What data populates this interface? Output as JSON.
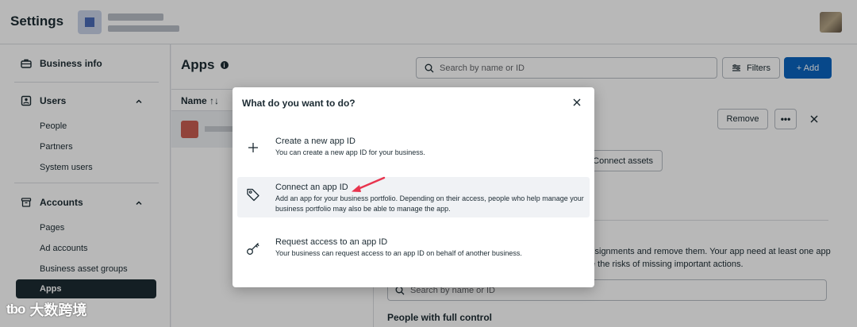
{
  "topbar": {
    "title": "Settings",
    "account_avatar_letter": "",
    "user_avatar": "user-avatar-photo"
  },
  "sidebar": {
    "business_info": "Business info",
    "users": {
      "label": "Users",
      "items": [
        "People",
        "Partners",
        "System users"
      ]
    },
    "accounts": {
      "label": "Accounts",
      "items": [
        "Pages",
        "Ad accounts",
        "Business asset groups",
        "Apps"
      ]
    },
    "active_item": "Apps"
  },
  "main": {
    "title": "Apps",
    "search_placeholder": "Search by name or ID",
    "filters_label": "Filters",
    "add_label": "+ Add",
    "list_header": "Name ↑↓",
    "remove_label": "Remove",
    "more_label": "•••",
    "connect_assets_label": "Connect assets",
    "desc_line_1": "ssignments and remove them. Your app need at least one app",
    "desc_line_2": "e the risks of missing important actions.",
    "people_search_placeholder": "Search by name or ID",
    "people_full_control": "People with full control"
  },
  "modal": {
    "title": "What do you want to do?",
    "options": [
      {
        "title": "Create a new app ID",
        "desc": "You can create a new app ID for your business.",
        "icon": "plus-icon"
      },
      {
        "title": "Connect an app ID",
        "desc": "Add an app for your business portfolio. Depending on their access, people who help manage your business portfolio may also be able to manage the app.",
        "icon": "tag-icon"
      },
      {
        "title": "Request access to an app ID",
        "desc": "Your business can request access to an app ID on behalf of another business.",
        "icon": "key-icon"
      }
    ]
  },
  "watermark": {
    "logo": "tbo",
    "text": "大数跨境"
  },
  "colors": {
    "primary_button": "#0b64c0",
    "active_nav": "#1c2b33",
    "annotation_arrow": "#e8344e"
  }
}
